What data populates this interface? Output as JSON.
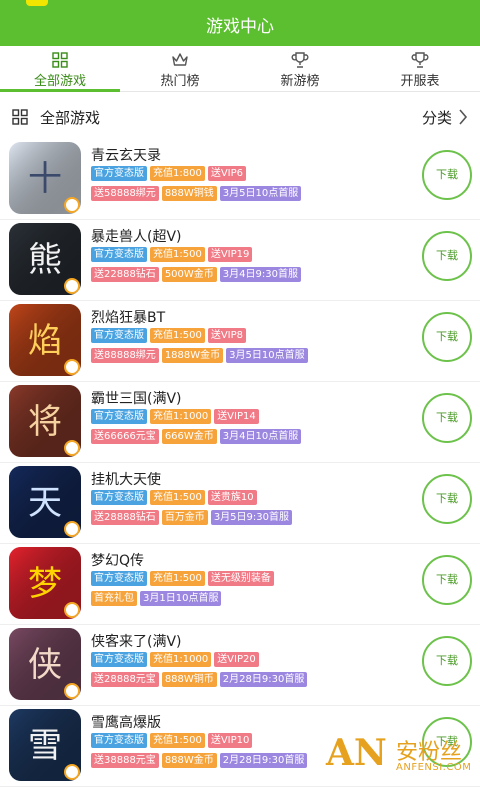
{
  "header": {
    "title": "游戏中心"
  },
  "tabs": [
    {
      "label": "全部游戏",
      "icon": "grid-icon",
      "active": true
    },
    {
      "label": "热门榜",
      "icon": "crown-icon",
      "active": false
    },
    {
      "label": "新游榜",
      "icon": "trophy-icon",
      "active": false
    },
    {
      "label": "开服表",
      "icon": "trophy-icon",
      "active": false
    }
  ],
  "section": {
    "title": "全部游戏",
    "category_label": "分类"
  },
  "download_label": "下载",
  "tag_colors": {
    "blue": "#4aa3e0",
    "orange": "#f5a33a",
    "pink": "#f07a86",
    "purple": "#9b86e0",
    "green": "#6dc24b"
  },
  "games": [
    {
      "name": "青云玄天录",
      "tags1": [
        "官方变态版",
        "充值1:800",
        "送VIP6"
      ],
      "tags2": [
        "送58888绑元",
        "888W铜钱",
        "3月5日10点首服"
      ]
    },
    {
      "name": "暴走兽人(超V)",
      "tags1": [
        "官方变态版",
        "充值1:500",
        "送VIP19"
      ],
      "tags2": [
        "送22888钻石",
        "500W金币",
        "3月4日9:30首服"
      ]
    },
    {
      "name": "烈焰狂暴BT",
      "tags1": [
        "官方变态版",
        "充值1:500",
        "送VIP8"
      ],
      "tags2": [
        "送88888绑元",
        "1888W金币",
        "3月5日10点首服"
      ]
    },
    {
      "name": "霸世三国(满V)",
      "tags1": [
        "官方变态版",
        "充值1:1000",
        "送VIP14"
      ],
      "tags2": [
        "送66666元宝",
        "666W金币",
        "3月4日10点首服"
      ]
    },
    {
      "name": "挂机大天使",
      "tags1": [
        "官方变态版",
        "充值1:500",
        "送贵族10"
      ],
      "tags2": [
        "送28888钻石",
        "百万金币",
        "3月5日9:30首服"
      ]
    },
    {
      "name": "梦幻Q传",
      "tags1": [
        "官方变态版",
        "充值1:500",
        "送无级别装备"
      ],
      "tags2": [
        "首充礼包",
        "3月1日10点首服"
      ]
    },
    {
      "name": "侠客来了(满V)",
      "tags1": [
        "官方变态版",
        "充值1:1000",
        "送VIP20"
      ],
      "tags2": [
        "送28888元宝",
        "888W铜币",
        "2月28日9:30首服"
      ]
    },
    {
      "name": "雪鹰高爆版",
      "tags1": [
        "官方变态版",
        "充值1:500",
        "送VIP10"
      ],
      "tags2": [
        "送38888元宝",
        "888W金币",
        "2月28日9:30首服"
      ]
    }
  ],
  "icon_art": [
    {
      "bg": "#dfe7f2",
      "fg": "#3b4a6b",
      "glyph": "十"
    },
    {
      "bg": "#2b3138",
      "fg": "#f2f2f2",
      "glyph": "熊"
    },
    {
      "bg": "#c2461a",
      "fg": "#ffcf5a",
      "glyph": "焰"
    },
    {
      "bg": "#8b3a2a",
      "fg": "#f5d2a0",
      "glyph": "将"
    },
    {
      "bg": "#152a5c",
      "fg": "#cfe3ff",
      "glyph": "天"
    },
    {
      "bg": "#e7232f",
      "fg": "#ffd400",
      "glyph": "梦"
    },
    {
      "bg": "#7a4a63",
      "fg": "#f3d9c8",
      "glyph": "侠"
    },
    {
      "bg": "#1e3a63",
      "fg": "#f2f2f2",
      "glyph": "雪"
    }
  ],
  "watermark": {
    "letters": "AN",
    "cn": "安粉丝",
    "en": "ANFENSI.COM"
  }
}
